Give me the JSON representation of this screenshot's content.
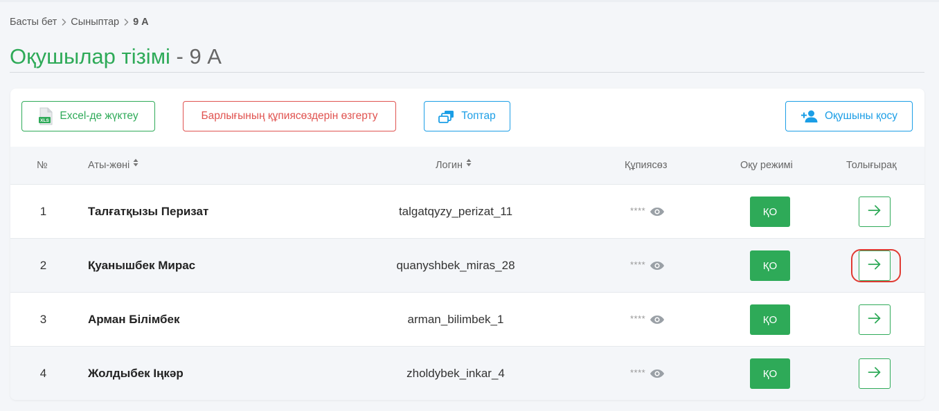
{
  "breadcrumb": {
    "home": "Басты бет",
    "classes": "Сыныптар",
    "current": "9 А"
  },
  "page_title": {
    "main": "Оқушылар тізімі",
    "suffix": " - 9 А"
  },
  "toolbar": {
    "excel_label": "Excel-де жүктеу",
    "reset_passwords_label": "Барлығының құпиясөздерін өзгерту",
    "groups_label": "Топтар",
    "add_student_label": "Оқушыны қосу"
  },
  "table": {
    "headers": {
      "num": "№",
      "name": "Аты-жөні",
      "login": "Логин",
      "password": "Құпиясөз",
      "mode": "Оқу режимі",
      "more": "Толығырақ"
    },
    "rows": [
      {
        "num": "1",
        "name": "Талғатқызы Перизат",
        "login": "talgatqyzy_perizat_11",
        "password": "****",
        "mode": "ҚО"
      },
      {
        "num": "2",
        "name": "Қуанышбек Мирас",
        "login": "quanyshbek_miras_28",
        "password": "****",
        "mode": "ҚО"
      },
      {
        "num": "3",
        "name": "Арман Білімбек",
        "login": "arman_bilimbek_1",
        "password": "****",
        "mode": "ҚО"
      },
      {
        "num": "4",
        "name": "Жолдыбек Іңкәр",
        "login": "zholdybek_inkar_4",
        "password": "****",
        "mode": "ҚО"
      }
    ]
  },
  "colors": {
    "green": "#2eaa58",
    "red": "#e0524f",
    "blue": "#1b9ee6",
    "highlight": "#e03a32"
  },
  "icons": [
    "chevron-right-icon",
    "xls-file-icon",
    "groups-icon",
    "add-user-icon",
    "sort-icon",
    "eye-icon",
    "arrow-right-icon"
  ]
}
